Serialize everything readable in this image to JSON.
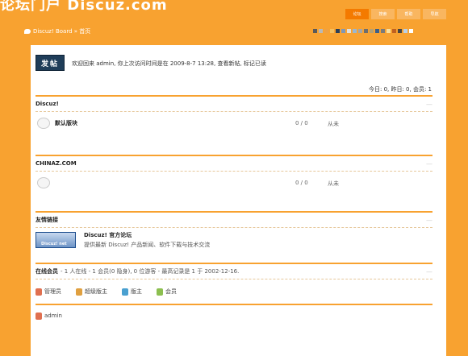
{
  "header": {
    "logo_text": "论坛门户 Discuz.com",
    "nav": [
      {
        "label": "论坛",
        "active": true
      },
      {
        "label": "搜索",
        "active": false
      },
      {
        "label": "帮助",
        "active": false
      },
      {
        "label": "导航",
        "active": false
      }
    ]
  },
  "breadcrumb": {
    "text": "Discuz! Board » 首页"
  },
  "style_swatches": [
    "#5a5a5a",
    "#b9b9b9",
    "#f0a040",
    "#f5c060",
    "#2a3f5a",
    "#7f97b5",
    "#e0e0e0",
    "#9ab7d0",
    "#a5a5a5",
    "#6e6e6e",
    "#b5a070",
    "#3a5f8a",
    "#7a7a7a",
    "#f8e0a0",
    "#c06020",
    "#444444",
    "#b8d0e8",
    "#ffffff"
  ],
  "toolbar": {
    "post_label": "发帖"
  },
  "welcome_text": "欢迎回来 admin, 你上次访问时间是在 2009-8-7 13:28, 查看新帖, 标记已读",
  "stats_text": "今日: 0, 昨日: 0, 会员: 1",
  "categories": [
    {
      "title": "Discuz!",
      "forum": {
        "name": "默认版块",
        "counts": "0 / 0",
        "last": "从未"
      }
    },
    {
      "title": "CHINAZ.COM",
      "forum": {
        "name": "",
        "counts": "0 / 0",
        "last": "从未"
      }
    }
  ],
  "links": {
    "title": "友情链接",
    "logo_text": "Discuz! net",
    "item_title": "Discuz! 官方论坛",
    "item_desc": "提供最新 Discuz! 产品新闻、软件下载与技术交流"
  },
  "online": {
    "title": "在线会员",
    "summary": "- 1 人在线 - 1 会员(0 隐身), 0 位游客 - 最高记录是 1 于 2002-12-16.",
    "legend": [
      {
        "label": "管理员",
        "color": "#e07050"
      },
      {
        "label": "超级版主",
        "color": "#e0a040"
      },
      {
        "label": "版主",
        "color": "#4aa0d0"
      },
      {
        "label": "会员",
        "color": "#8cbf50"
      }
    ],
    "users": [
      {
        "name": "admin",
        "color": "#e07050"
      }
    ]
  },
  "toggle_glyph": "—"
}
